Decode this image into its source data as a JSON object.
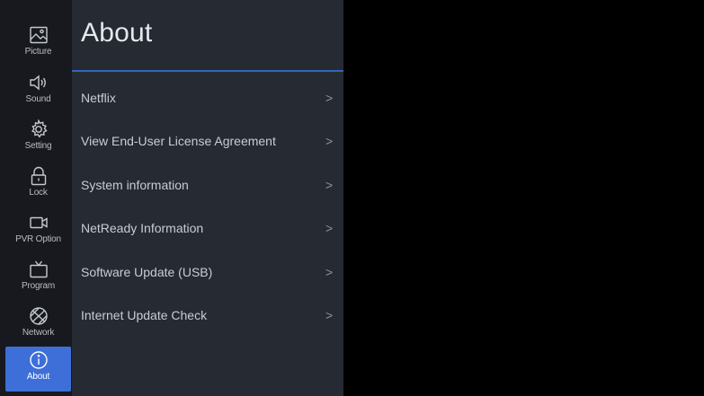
{
  "sidebar": {
    "items": [
      {
        "label": "Picture",
        "icon": "picture-icon",
        "active": false
      },
      {
        "label": "Sound",
        "icon": "speaker-icon",
        "active": false
      },
      {
        "label": "Setting",
        "icon": "gear-icon",
        "active": false
      },
      {
        "label": "Lock",
        "icon": "lock-icon",
        "active": false
      },
      {
        "label": "PVR Option",
        "icon": "camera-icon",
        "active": false
      },
      {
        "label": "Program",
        "icon": "tv-icon",
        "active": false
      },
      {
        "label": "Network",
        "icon": "globe-icon",
        "active": false
      },
      {
        "label": "About",
        "icon": "info-icon",
        "active": true
      }
    ]
  },
  "panel": {
    "title": "About",
    "items": [
      {
        "label": "Netflix",
        "chevron": ">"
      },
      {
        "label": "View End-User License Agreement",
        "chevron": ">"
      },
      {
        "label": "System information",
        "chevron": ">"
      },
      {
        "label": "NetReady Information",
        "chevron": ">"
      },
      {
        "label": "Software Update (USB)",
        "chevron": ">"
      },
      {
        "label": "Internet Update Check",
        "chevron": ">"
      }
    ]
  },
  "colors": {
    "sidebar_bg": "#17191e",
    "panel_bg": "#252a33",
    "accent": "#3e6fd8",
    "title_rule": "#2f66b8",
    "screen_bg": "#000000"
  }
}
